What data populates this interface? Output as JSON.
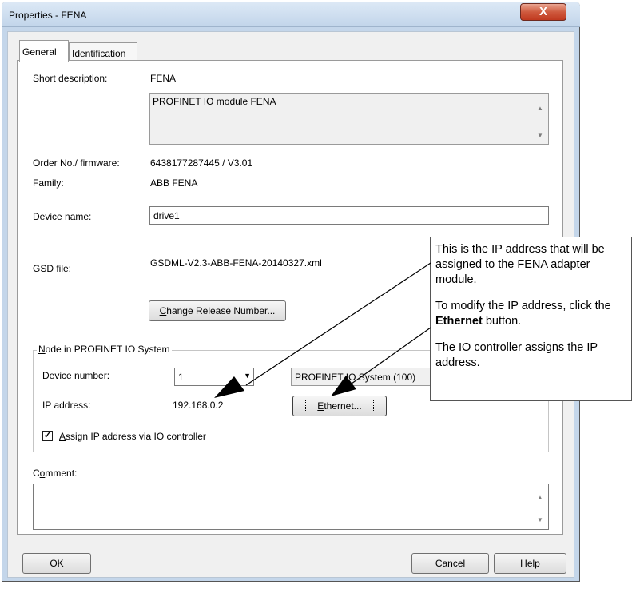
{
  "window": {
    "title": "Properties - FENA",
    "close_label": "X"
  },
  "tabs": [
    {
      "label": "General",
      "active": true
    },
    {
      "label": "Identification",
      "active": false
    }
  ],
  "general": {
    "short_description_label": "Short description:",
    "short_description_value": "FENA",
    "description_text": "PROFINET IO module FENA",
    "order_label": "Order No./ firmware:",
    "order_value": "6438177287445 / V3.01",
    "family_label": "Family:",
    "family_value": "ABB FENA",
    "device_name_label_ul": "D",
    "device_name_label_rest": "evice name:",
    "device_name_value": "drive1",
    "gsd_label": "GSD file:",
    "gsd_value": "GSDML-V2.3-ABB-FENA-20140327.xml",
    "change_release_ul": "C",
    "change_release_rest": "hange Release Number..."
  },
  "node_group": {
    "title_ul": "N",
    "title_rest": "ode in PROFINET IO System",
    "device_number_label_a": "D",
    "device_number_label_ul": "e",
    "device_number_label_b": "vice number:",
    "device_number_value": "1",
    "io_system_text": "PROFINET IO System (100)",
    "ip_label": "IP address:",
    "ip_value": "192.168.0.2",
    "ethernet_ul": "E",
    "ethernet_rest": "thernet...",
    "assign_ip_checked": true,
    "assign_ip_ul": "A",
    "assign_ip_rest": "ssign IP address via IO controller"
  },
  "comment": {
    "label_a": "C",
    "label_ul": "o",
    "label_b": "mment:",
    "value": ""
  },
  "footer": {
    "ok_label": "OK",
    "cancel_label": "Cancel",
    "help_label": "Help"
  },
  "callout": {
    "p1": "This is the IP address that will be assigned to the FENA adapter module.",
    "p2_before": "To modify the IP address, click the ",
    "p2_bold": "Ethernet",
    "p2_after": " button.",
    "p3": "The IO controller assigns the IP address."
  }
}
